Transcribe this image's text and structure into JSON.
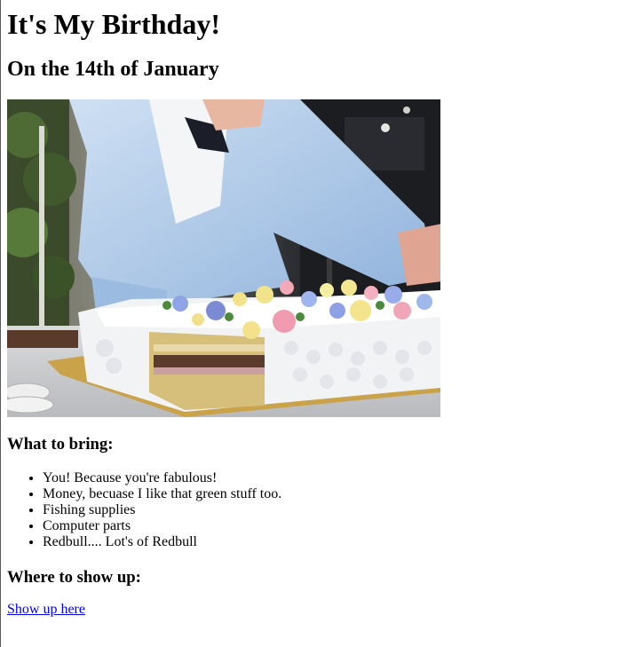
{
  "page": {
    "title": "It's My Birthday!",
    "subtitle": "On the 14th of January"
  },
  "image": {
    "subject": "birthday cake being smashed",
    "colors": {
      "suit": "#a9c6e8",
      "frosting": "#f2f3f5",
      "cake": "#d6bf7a",
      "board": "#c9a24a",
      "background": "#1a1b1f"
    }
  },
  "bring": {
    "heading": "What to bring:",
    "items": [
      "You! Because you're fabulous!",
      "Money, becuase I like that green stuff too.",
      "Fishing supplies",
      "Computer parts",
      "Redbull.... Lot's of Redbull"
    ]
  },
  "location": {
    "heading": "Where to show up:",
    "link_label": "Show up here"
  },
  "theme": {
    "link_color": "#0000ee",
    "text_color": "#000000"
  }
}
